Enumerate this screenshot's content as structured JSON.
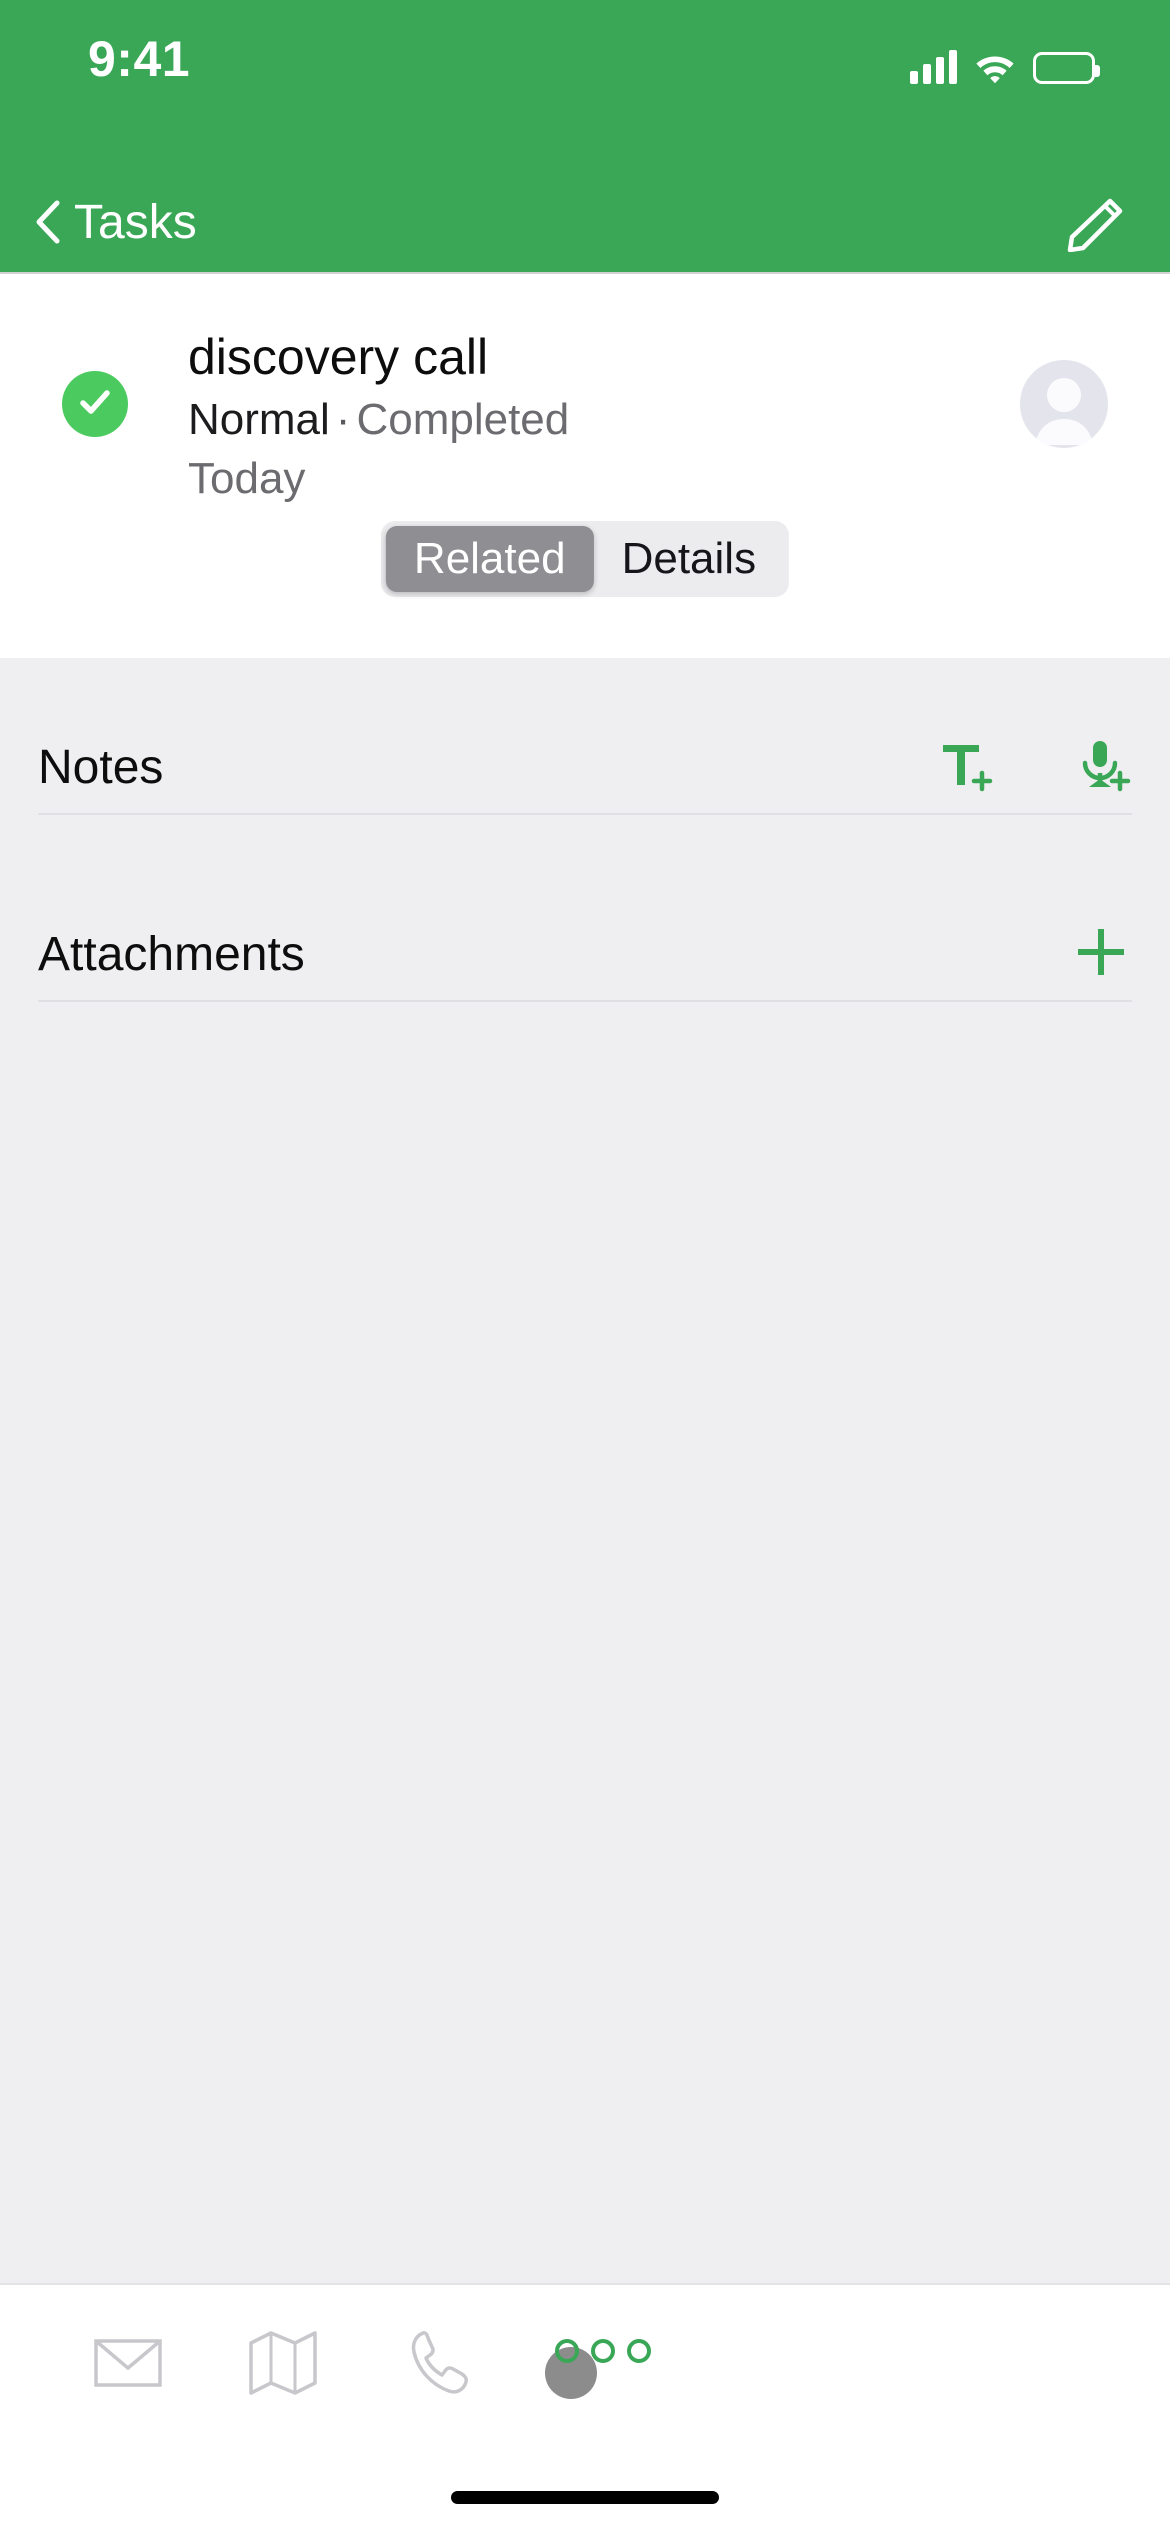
{
  "status_bar": {
    "time": "9:41",
    "cellular_icon": "signal-bars-icon",
    "wifi_icon": "wifi-icon",
    "battery_icon": "battery-icon"
  },
  "nav_bar": {
    "back_label": "Tasks",
    "back_icon": "chevron-left-icon",
    "edit_icon": "pencil-icon",
    "background_color": "#3aa757"
  },
  "task": {
    "completed_icon": "check-circle-icon",
    "title": "discovery call",
    "priority": "Normal",
    "separator": "·",
    "status": "Completed",
    "due": "Today",
    "avatar_icon": "person-avatar-icon"
  },
  "segmented_control": {
    "options": [
      {
        "label": "Related",
        "selected": true
      },
      {
        "label": "Details",
        "selected": false
      }
    ],
    "selected_color": "#8e8e93",
    "track_color": "#ececee"
  },
  "sections": [
    {
      "title": "Notes",
      "actions": [
        {
          "icon": "add-text-note-icon",
          "color": "#3aa757"
        },
        {
          "icon": "add-voice-note-icon",
          "color": "#3aa757"
        }
      ]
    },
    {
      "title": "Attachments",
      "actions": [
        {
          "icon": "plus-icon",
          "color": "#3aa757"
        }
      ]
    }
  ],
  "toolbar": {
    "items": [
      {
        "icon": "email-icon"
      },
      {
        "icon": "map-icon"
      },
      {
        "icon": "phone-icon"
      },
      {
        "icon": "status-dots-icon"
      }
    ]
  },
  "home_indicator": {
    "name": "home-indicator"
  }
}
